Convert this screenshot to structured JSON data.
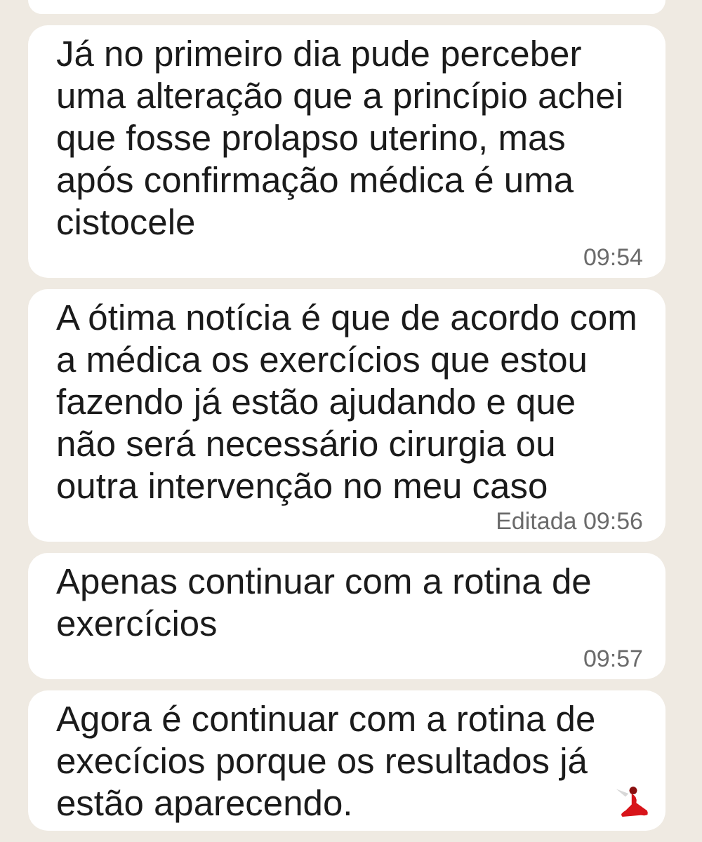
{
  "messages": [
    {
      "text": "Já no primeiro dia pude perceber uma alteração que a princípio achei que fosse prolapso uterino, mas após confirmação médica é uma cistocele",
      "time": "09:54"
    },
    {
      "text": "A ótima notícia é que de acordo com a médica os exercícios que estou fazendo já estão ajudando e que não será necessário cirurgia ou outra intervenção no meu caso",
      "time": "Editada 09:56"
    },
    {
      "text": "Apenas continuar com a rotina de exercícios",
      "time": "09:57"
    },
    {
      "text": "Agora é continuar com a rotina de execícios porque os resultados já estão aparecendo."
    }
  ]
}
